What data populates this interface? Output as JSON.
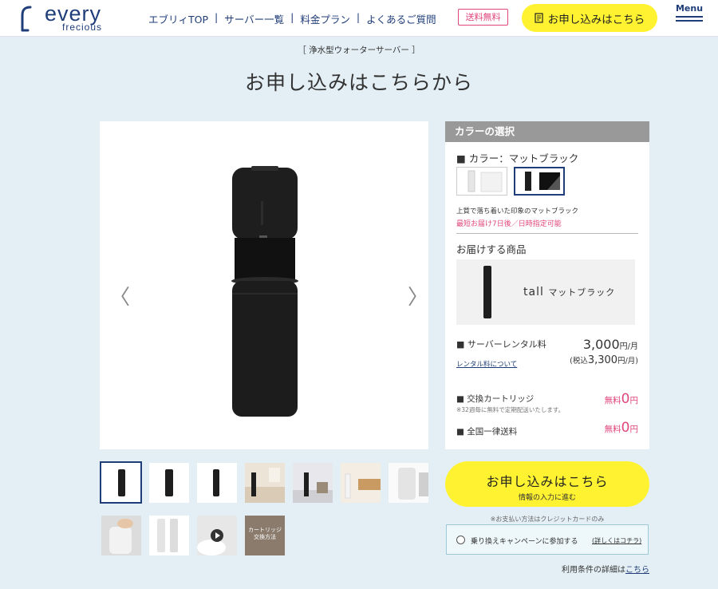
{
  "header": {
    "logo_main": "every",
    "logo_sub": "frecious",
    "nav": [
      "エブリィTOP",
      "サーバー一覧",
      "料金プラン",
      "よくあるご質問"
    ],
    "nav_separator": "|",
    "free_shipping": "送料無料",
    "cta": "お申し込みはこちら",
    "menu": "Menu"
  },
  "page": {
    "eyebrow": "［ 浄水型ウォーターサーバー ］",
    "title": "お申し込みはこちらから"
  },
  "gallery": {
    "prev": "〈",
    "next": "〉",
    "video_thumb_text": "カートリッジ交換方法"
  },
  "panel": {
    "header": "カラーの選択",
    "color_label": "■ カラー：マットブラック",
    "color_desc": "上質で落ち着いた印象のマットブラック",
    "delivery": "最短お届け7日後／日時指定可能",
    "deliver_title": "お届けする商品",
    "product_name": "tall",
    "product_color": "マットブラック",
    "rental_label": "■ サーバーレンタル料",
    "rental_price": "3,000",
    "rental_unit": "円/月",
    "rental_link": "レンタル料について",
    "rental_tax_prefix": "(税込",
    "rental_tax_price": "3,300",
    "rental_tax_unit": "円/月)",
    "cartridge_label": "■ 交換カートリッジ",
    "cartridge_note": "※32週毎に無料で定期配送いたします。",
    "free_word": "無料",
    "zero": "0",
    "yen": "円",
    "shipping_label": "■ 全国一律送料"
  },
  "apply": {
    "main": "お申し込みはこちら",
    "sub": "情報の入力に進む"
  },
  "payment_note": "※お支払い方法はクレジットカードのみ",
  "campaign": {
    "label": "乗り換えキャンペーンに参加する",
    "link": "(詳しくはコチラ)"
  },
  "terms": {
    "prefix": "利用条件の詳細は",
    "link": "こちら"
  },
  "colors": {
    "navy": "#1f3d78",
    "yellow": "#fff230",
    "pink": "#e0467c",
    "background": "#e4eff5"
  }
}
